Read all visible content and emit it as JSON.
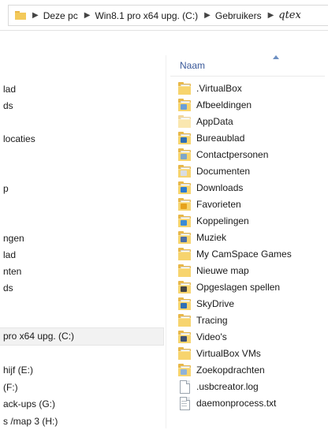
{
  "address_bar": {
    "crumbs": [
      "Deze pc",
      "Win8.1 pro x64 upg. (C:)",
      "Gebruikers",
      "qtex"
    ]
  },
  "nav_pane": {
    "items": [
      {
        "label": "lad"
      },
      {
        "label": "ds"
      },
      {
        "label": "locaties"
      },
      {
        "label": "p"
      },
      {
        "label": "ngen"
      },
      {
        "label": "lad"
      },
      {
        "label": "nten"
      },
      {
        "label": "ds"
      },
      {
        "label": "pro x64 upg. (C:)",
        "selected": true
      },
      {
        "label": "hijf (E:)"
      },
      {
        "label": "(F:)"
      },
      {
        "label": "ack-ups (G:)"
      },
      {
        "label": "s /map 3 (H:)"
      }
    ]
  },
  "content": {
    "column_header": "Naam",
    "items": [
      {
        "name": ".VirtualBox",
        "icon": "folder-icon",
        "overlay": ""
      },
      {
        "name": "Afbeeldingen",
        "icon": "pictures-folder-icon",
        "overlay": "#6a9fd8"
      },
      {
        "name": "AppData",
        "icon": "folder-icon",
        "overlay": "",
        "faded": true
      },
      {
        "name": "Bureaublad",
        "icon": "desktop-folder-icon",
        "overlay": "#2f6fb5"
      },
      {
        "name": "Contactpersonen",
        "icon": "contacts-folder-icon",
        "overlay": "#7fa7c9"
      },
      {
        "name": "Documenten",
        "icon": "documents-folder-icon",
        "overlay": "#d9dde2"
      },
      {
        "name": "Downloads",
        "icon": "downloads-folder-icon",
        "overlay": "#2b7bd1"
      },
      {
        "name": "Favorieten",
        "icon": "favorites-folder-icon",
        "overlay": "#e6a21d"
      },
      {
        "name": "Koppelingen",
        "icon": "links-folder-icon",
        "overlay": "#3a8cd6"
      },
      {
        "name": "Muziek",
        "icon": "music-folder-icon",
        "overlay": "#4b6ea8"
      },
      {
        "name": "My CamSpace Games",
        "icon": "folder-icon",
        "overlay": ""
      },
      {
        "name": "Nieuwe map",
        "icon": "folder-icon",
        "overlay": ""
      },
      {
        "name": "Opgeslagen spellen",
        "icon": "saved-games-folder-icon",
        "overlay": "#444444"
      },
      {
        "name": "SkyDrive",
        "icon": "skydrive-folder-icon",
        "overlay": "#2f6fb5"
      },
      {
        "name": "Tracing",
        "icon": "folder-icon",
        "overlay": ""
      },
      {
        "name": "Video's",
        "icon": "videos-folder-icon",
        "overlay": "#3d4f73"
      },
      {
        "name": "VirtualBox VMs",
        "icon": "folder-icon",
        "overlay": ""
      },
      {
        "name": "Zoekopdrachten",
        "icon": "searches-folder-icon",
        "overlay": "#8fb3d9"
      },
      {
        "name": ".usbcreator.log",
        "icon": "file-icon",
        "overlay": ""
      },
      {
        "name": "daemonprocess.txt",
        "icon": "text-file-icon",
        "overlay": ""
      }
    ]
  }
}
